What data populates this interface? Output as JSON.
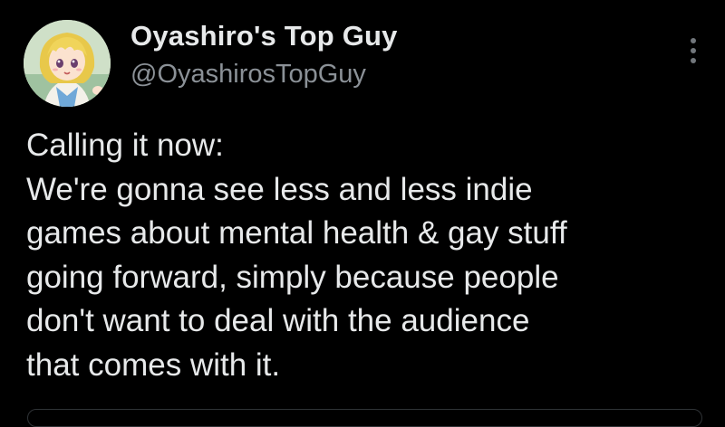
{
  "tweet": {
    "author": {
      "display_name": "Oyashiro's Top Guy",
      "handle": "@OyashirosTopGuy",
      "avatar_icon": "anime-girl-avatar"
    },
    "more_icon": "more-vertical-icon",
    "body_lines": [
      "Calling it now:",
      "We're gonna see less and less indie",
      "games about mental health & gay stuff",
      "going forward, simply because people",
      "don't want to deal with the audience",
      "that comes with it."
    ]
  },
  "colors": {
    "background": "#000000",
    "text_primary": "#e7e9ea",
    "text_secondary": "#8b9197",
    "icon_muted": "#71767b",
    "border": "#2f3336"
  }
}
